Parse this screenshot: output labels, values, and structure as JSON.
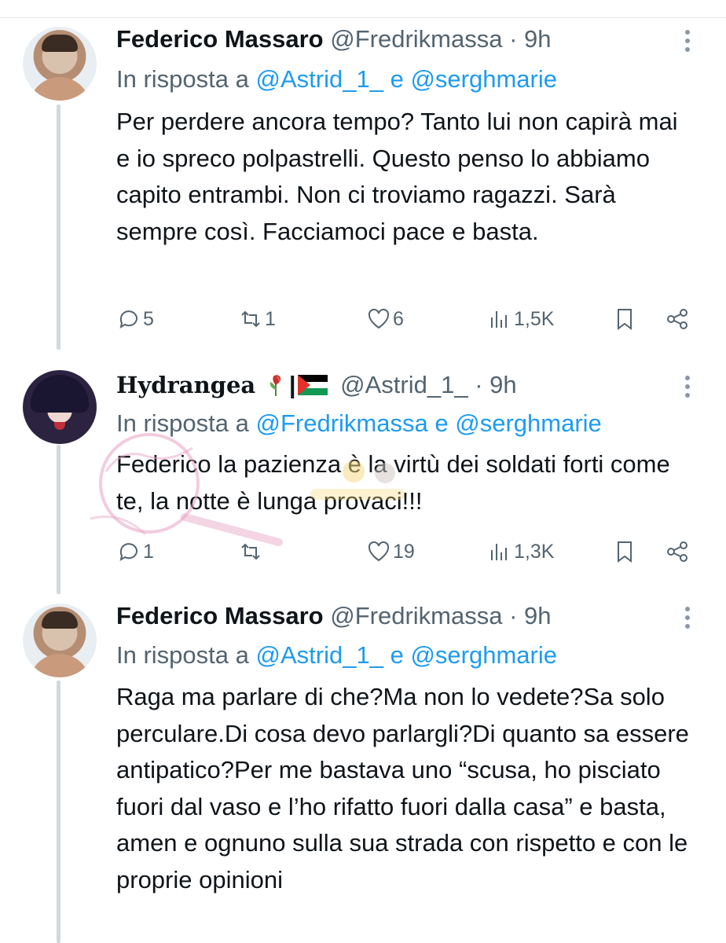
{
  "tweets": [
    {
      "name": "Federico Massaro",
      "handle": "@Fredrikmassa",
      "separator": "·",
      "time": "9h",
      "reply_prefix": "In risposta a",
      "reply_mention_1": "@Astrid_1_",
      "reply_joiner": "e",
      "reply_mention_2": "@serghmarie",
      "text": "Per perdere ancora tempo? Tanto lui non capirà mai e io spreco polpastrelli. Questo penso lo abbiamo capito entrambi. Non ci troviamo ragazzi. Sarà sempre così. Facciamoci pace e basta.",
      "replies": "5",
      "retweets": "1",
      "likes": "6",
      "views": "1,5K",
      "avatar": "avatar-photo-man"
    },
    {
      "name": "Hydrangea",
      "name_suffix": "|",
      "handle": "@Astrid_1_",
      "separator": "·",
      "time": "9h",
      "reply_prefix": "In risposta a",
      "reply_mention_1": "@Fredrikmassa",
      "reply_joiner": "e",
      "reply_mention_2": "@serghmarie",
      "text": "Federico la pazienza è la virtù dei soldati forti come te, la notte è lunga provaci!!!",
      "replies": "1",
      "retweets": "",
      "likes": "19",
      "views": "1,3K",
      "avatar": "avatar-anime-girl",
      "emoji": [
        "wilted-flower-emoji",
        "palestine-flag-emoji"
      ]
    },
    {
      "name": "Federico Massaro",
      "handle": "@Fredrikmassa",
      "separator": "·",
      "time": "9h",
      "reply_prefix": "In risposta a",
      "reply_mention_1": "@Astrid_1_",
      "reply_joiner": "e",
      "reply_mention_2": "@serghmarie",
      "text": "Raga ma parlare di che?Ma non lo vedete?Sa solo perculare.Di cosa devo parlargli?Di quanto sa essere antipatico?Per me bastava uno “scusa, ho pisciato fuori dal vaso e l’ho rifatto fuori dalla casa” e basta, amen e ognuno sulla sua strada con rispetto e con le proprie opinioni",
      "avatar": "avatar-photo-man"
    }
  ],
  "colors": {
    "text": "#0f1419",
    "secondary": "#536471",
    "link": "#1d9bf0",
    "thread_line": "#cfd9de"
  },
  "watermark": "watermark-logo"
}
